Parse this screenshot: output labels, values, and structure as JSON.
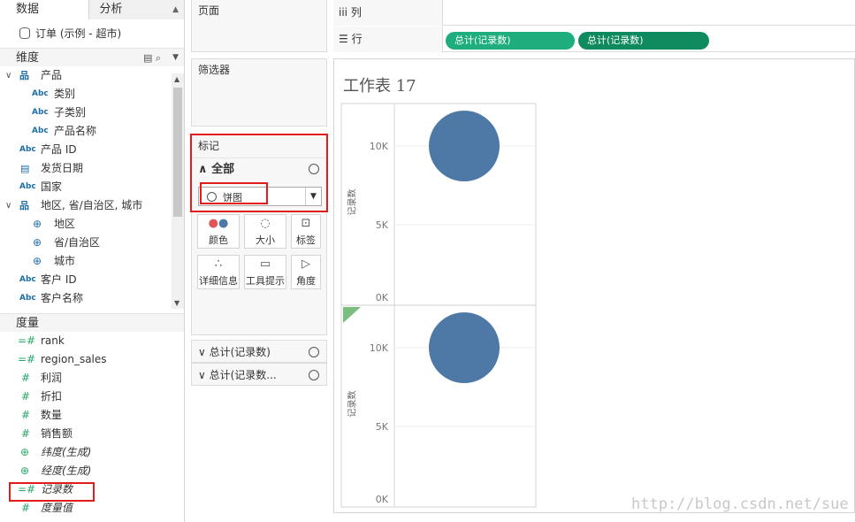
{
  "tabs": {
    "data": "数据",
    "analysis": "分析"
  },
  "datasource": "订单 (示例 - 超市)",
  "dimensions": {
    "header": "维度",
    "items": [
      {
        "icon": "Abc",
        "label": "产品"
      },
      {
        "icon": "Abc",
        "label": "类别"
      },
      {
        "icon": "Abc",
        "label": "子类别"
      },
      {
        "icon": "Abc",
        "label": "产品名称"
      },
      {
        "icon": "Abc",
        "label": "产品 ID"
      },
      {
        "icon": "date",
        "label": "发货日期"
      },
      {
        "icon": "Abc",
        "label": "国家"
      },
      {
        "icon": "hier",
        "label": "地区, 省/自治区, 城市"
      },
      {
        "icon": "geo",
        "label": "地区"
      },
      {
        "icon": "geo",
        "label": "省/自治区"
      },
      {
        "icon": "geo",
        "label": "城市"
      },
      {
        "icon": "Abc",
        "label": "客户 ID"
      },
      {
        "icon": "Abc",
        "label": "客户名称"
      }
    ]
  },
  "measures": {
    "header": "度量",
    "items": [
      {
        "label": "rank"
      },
      {
        "label": "region_sales"
      },
      {
        "label": "利润"
      },
      {
        "label": "折扣"
      },
      {
        "label": "数量"
      },
      {
        "label": "销售额"
      },
      {
        "label": "纬度(生成)"
      },
      {
        "label": "经度(生成)"
      },
      {
        "label": "记录数"
      },
      {
        "label": "度量值"
      }
    ]
  },
  "shelves": {
    "pages": "页面",
    "filters": "筛选器",
    "columns": "列",
    "rows": "行",
    "row_pills": [
      "总计(记录数)",
      "总计(记录数)"
    ]
  },
  "marks": {
    "title": "标记",
    "all": "全部",
    "type": "饼图",
    "buttons": [
      "颜色",
      "大小",
      "标签",
      "详细信息",
      "工具提示",
      "角度"
    ],
    "sub_cards": [
      "总计(记录数)",
      "总计(记录数..."
    ]
  },
  "view": {
    "title": "工作表 17",
    "ylabel": "记录数",
    "ticks": [
      "10K",
      "5K",
      "0K"
    ]
  },
  "colors": {
    "pill_green": "#1eae7e",
    "pill_green_dark": "#0f8a5f",
    "circle": "#4e79a7"
  },
  "watermark": "http://blog.csdn.net/sue"
}
